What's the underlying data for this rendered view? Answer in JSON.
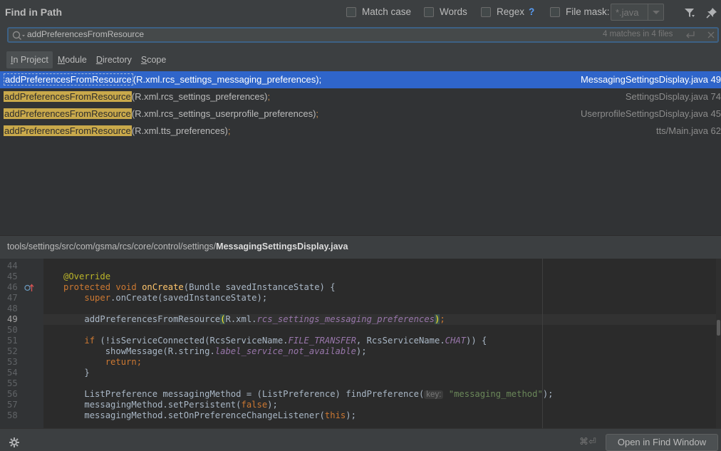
{
  "header": {
    "title": "Find in Path",
    "match_case_label": "Match case",
    "words_label": "Words",
    "regex_label": "Regex",
    "regex_help": "?",
    "file_mask_label": "File mask:",
    "file_mask_placeholder": "*.java"
  },
  "search": {
    "value": "addPreferencesFromResource",
    "match_count": "4 matches in 4 files"
  },
  "tabs": [
    {
      "label": "In Project",
      "active": true
    },
    {
      "label": "Module",
      "active": false
    },
    {
      "label": "Directory",
      "active": false
    },
    {
      "label": "Scope",
      "active": false
    }
  ],
  "results": [
    {
      "match": "addPreferencesFromResource",
      "rest": "(R.xml.rcs_settings_messaging_preferences)",
      "semi": ";",
      "file": "MessagingSettingsDisplay.java 49",
      "selected": true
    },
    {
      "match": "addPreferencesFromResource",
      "rest": "(R.xml.rcs_settings_preferences)",
      "semi": ";",
      "file": "SettingsDisplay.java 74",
      "selected": false
    },
    {
      "match": "addPreferencesFromResource",
      "rest": "(R.xml.rcs_settings_userprofile_preferences)",
      "semi": ";",
      "file": "UserprofileSettingsDisplay.java 45",
      "selected": false
    },
    {
      "match": "addPreferencesFromResource",
      "rest": "(R.xml.tts_preferences)",
      "semi": ";",
      "file": "tts/Main.java 62",
      "selected": false
    }
  ],
  "preview": {
    "path_prefix": "tools/settings/src/com/gsma/rcs/core/control/settings/",
    "path_file": "MessagingSettingsDisplay.java",
    "line_numbers": [
      "44",
      "45",
      "46",
      "47",
      "48",
      "49",
      "50",
      "51",
      "52",
      "53",
      "54",
      "55",
      "56",
      "57",
      "58"
    ],
    "current_line": "49",
    "code": {
      "l45_annotation": "@Override",
      "l46_k": "protected void ",
      "l46_fn": "onCreate",
      "l46_rest": "(Bundle savedInstanceState) {",
      "l47_k": "super",
      "l47_rest": ".onCreate(savedInstanceState);",
      "l49_call": "addPreferencesFromResource",
      "l49_open": "(",
      "l49_mid": "R.xml.",
      "l49_it": "rcs_settings_messaging_preferences",
      "l49_close": ")",
      "l49_end": ";",
      "l51_k": "if ",
      "l51_a": "(!isServiceConnected(RcsServiceName.",
      "l51_it1": "FILE_TRANSFER",
      "l51_b": ", RcsServiceName.",
      "l51_it2": "CHAT",
      "l51_c": ")) {",
      "l52_a": "showMessage(R.string.",
      "l52_it": "label_service_not_available",
      "l52_b": ");",
      "l53_k": "return",
      "l53_b": ";",
      "l54": "}",
      "l56_a": "ListPreference messagingMethod = (ListPreference) findPreference(",
      "l56_hint": "key:",
      "l56_str": "\"messaging_method\"",
      "l56_b": ");",
      "l57_a": "messagingMethod.setPersistent(",
      "l57_k": "false",
      "l57_b": ");",
      "l58_a": "messagingMethod.setOnPreferenceChangeListener(",
      "l58_k": "this",
      "l58_b": ");"
    }
  },
  "footer": {
    "shortcut": "⌘⏎",
    "open_button": "Open in Find Window"
  },
  "colors": {
    "selection": "#2f65ca",
    "match_highlight": "#c9a94b",
    "search_focus": "#3d6185"
  }
}
